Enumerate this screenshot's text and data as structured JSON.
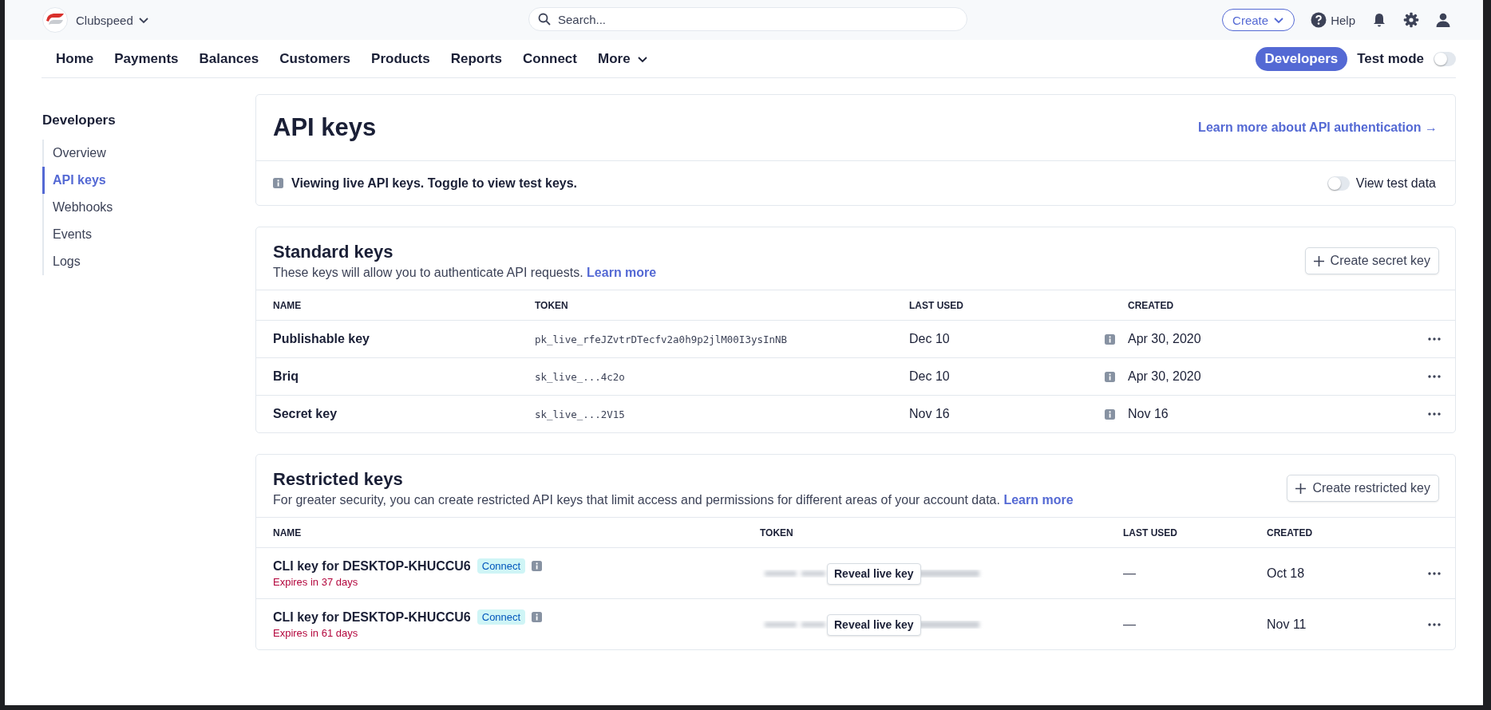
{
  "top_bar": {
    "account": "Clubspeed",
    "search": {
      "placeholder": "Search..."
    },
    "create_button": "Create",
    "help_link": "Help"
  },
  "nav": {
    "items": [
      {
        "label": "Home",
        "kind": "link"
      },
      {
        "label": "Payments",
        "kind": "link"
      },
      {
        "label": "Balances",
        "kind": "link"
      },
      {
        "label": "Customers",
        "kind": "link"
      },
      {
        "label": "Products",
        "kind": "link"
      },
      {
        "label": "Reports",
        "kind": "link"
      },
      {
        "label": "Connect",
        "kind": "link"
      },
      {
        "label": "More",
        "kind": "dropdown"
      }
    ],
    "developers_button": "Developers",
    "test_mode": {
      "label": "Test mode",
      "on": false
    }
  },
  "sidebar": {
    "title": "Developers",
    "items": [
      {
        "label": "Overview",
        "selected": false
      },
      {
        "label": "API keys",
        "selected": true
      },
      {
        "label": "Webhooks",
        "selected": false
      },
      {
        "label": "Events",
        "selected": false
      },
      {
        "label": "Logs",
        "selected": false
      }
    ]
  },
  "header_card": {
    "title": "API keys",
    "link": "Learn more about API authentication →",
    "notice": "Viewing live API keys. Toggle to view test keys.",
    "view_test_data": {
      "label": "View test data",
      "on": false
    }
  },
  "standard_keys": {
    "title": "Standard keys",
    "description": "These keys will allow you to authenticate API requests.",
    "learn_more": "Learn more",
    "button": "Create secret key",
    "columns": [
      "NAME",
      "TOKEN",
      "LAST USED",
      "CREATED"
    ],
    "rows": [
      {
        "name": "Publishable key",
        "token": "pk_live_rfeJZvtrDTecfv2a0h9p2jlM00I3ysInNB",
        "last_used": "Dec 10",
        "created": "Apr 30, 2020"
      },
      {
        "name": "Briq",
        "token": "sk_live_...4c2o",
        "last_used": "Dec 10",
        "created": "Apr 30, 2020"
      },
      {
        "name": "Secret key",
        "token": "sk_live_...2V15",
        "last_used": "Nov 16",
        "created": "Nov 16"
      }
    ]
  },
  "restricted_keys": {
    "title": "Restricted keys",
    "description": "For greater security, you can create restricted API keys that limit access and permissions for different areas of your account data.",
    "learn_more": "Learn more",
    "button": "Create restricted key",
    "columns": [
      "NAME",
      "TOKEN",
      "LAST USED",
      "CREATED"
    ],
    "rows": [
      {
        "name": "CLI key for DESKTOP-KHUCCU6",
        "tag": "Connect",
        "expires": "Expires in 37 days",
        "reveal_button": "Reveal live key",
        "last_used": "—",
        "created": "Oct 18"
      },
      {
        "name": "CLI key for DESKTOP-KHUCCU6",
        "tag": "Connect",
        "expires": "Expires in 61 days",
        "reveal_button": "Reveal live key",
        "last_used": "—",
        "created": "Nov 11"
      }
    ]
  }
}
